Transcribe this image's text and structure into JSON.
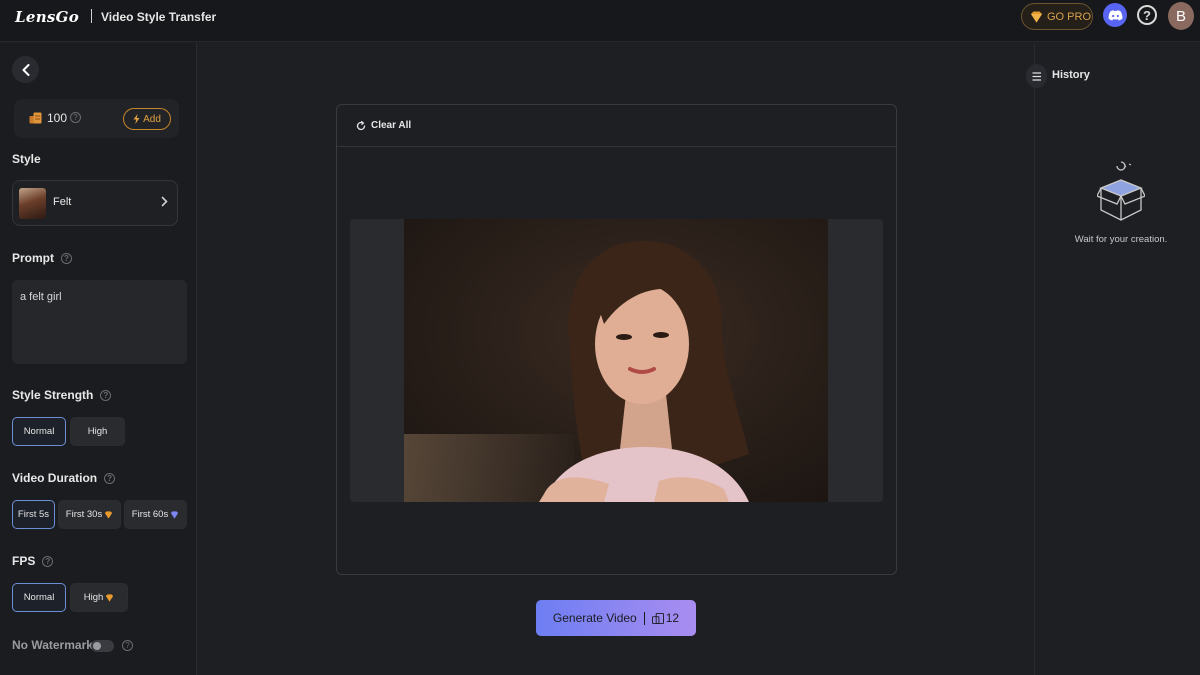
{
  "header": {
    "logo": "LensGo",
    "app_title": "Video Style Transfer",
    "go_pro_label": "GO PRO",
    "avatar_initial": "B"
  },
  "sidebar": {
    "credits": "100",
    "add_label": "Add",
    "style_label": "Style",
    "style_value": "Felt",
    "prompt_label": "Prompt",
    "prompt_value": "a felt girl",
    "style_strength": {
      "label": "Style Strength",
      "options": [
        "Normal",
        "High"
      ],
      "selected": "Normal"
    },
    "video_duration": {
      "label": "Video Duration",
      "options": [
        "First 5s",
        "First 30s",
        "First 60s"
      ],
      "selected": "First 5s"
    },
    "fps": {
      "label": "FPS",
      "options": [
        "Normal",
        "High"
      ],
      "selected": "Normal"
    },
    "watermark_label": "No Watermark",
    "watermark_enabled": false
  },
  "main": {
    "clear_all_label": "Clear All",
    "generate_label": "Generate Video",
    "generate_cost": "12"
  },
  "history": {
    "label": "History",
    "empty_text": "Wait for your creation."
  },
  "colors": {
    "accent_gold": "#d9a34a",
    "discord": "#5865f2",
    "selected_border": "#6b8fd6",
    "generate_gradient_start": "#6d7ef2",
    "generate_gradient_end": "#a98df0"
  }
}
